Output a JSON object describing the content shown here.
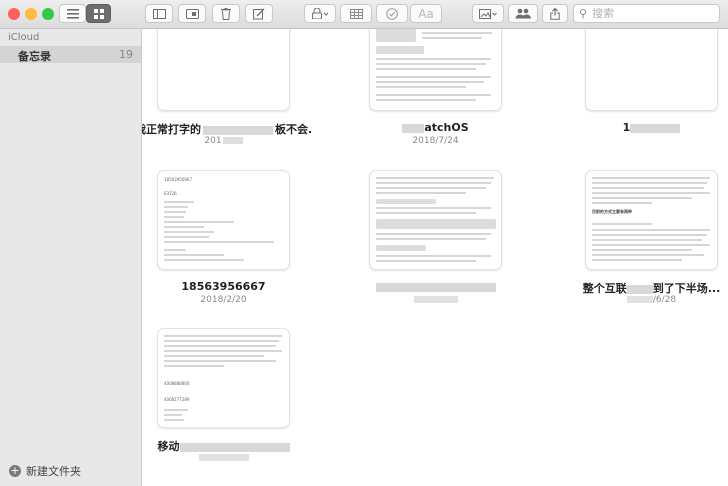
{
  "toolbar": {
    "buttons": [
      {
        "name": "list-view-button",
        "icon": "list-icon"
      },
      {
        "name": "gallery-view-button",
        "icon": "grid-icon"
      },
      {
        "name": "sidebar-toggle-button",
        "icon": "sidebar-icon"
      },
      {
        "name": "attachments-button",
        "icon": "attachment-browser-icon"
      },
      {
        "name": "delete-button",
        "icon": "trash-icon"
      },
      {
        "name": "compose-button",
        "icon": "compose-icon"
      },
      {
        "name": "lock-button",
        "icon": "lock-icon"
      },
      {
        "name": "table-button",
        "icon": "table-icon"
      },
      {
        "name": "checklist-button",
        "icon": "checkmark-icon"
      },
      {
        "name": "format-button",
        "icon": "format-icon",
        "label": "Aa"
      },
      {
        "name": "media-button",
        "icon": "photo-icon"
      },
      {
        "name": "collaborate-button",
        "icon": "people-icon"
      },
      {
        "name": "share-button",
        "icon": "share-icon"
      }
    ],
    "search_placeholder": "搜索"
  },
  "sidebar": {
    "account": "iCloud",
    "folders": [
      {
        "label": "备忘录",
        "count": "19"
      }
    ],
    "new_folder_label": "新建文件夹"
  },
  "notes": [
    {
      "title": "我正常打字的",
      "date": "201"
    },
    {
      "title": "atchOS",
      "date": "2018/7/24"
    },
    {
      "title": "1",
      "date": ""
    },
    {
      "title": "18563956667",
      "date": "2018/2/20",
      "snippet": [
        "18563956667",
        "",
        "E3726"
      ]
    },
    {
      "title": "",
      "date": ""
    },
    {
      "title": "整个互联",
      "date": "/6/28",
      "snippet": [
        "目前的方式主要有两种"
      ]
    },
    {
      "title": "移动",
      "date": "",
      "snippet": [
        "4008888800",
        "",
        "4008177289"
      ]
    }
  ],
  "colors": {
    "close": "#fc605c",
    "minimize": "#fdbc40",
    "zoom": "#34c84a",
    "sidebar_bg": "#e8e8e8",
    "selection": "#d4d4d4"
  }
}
